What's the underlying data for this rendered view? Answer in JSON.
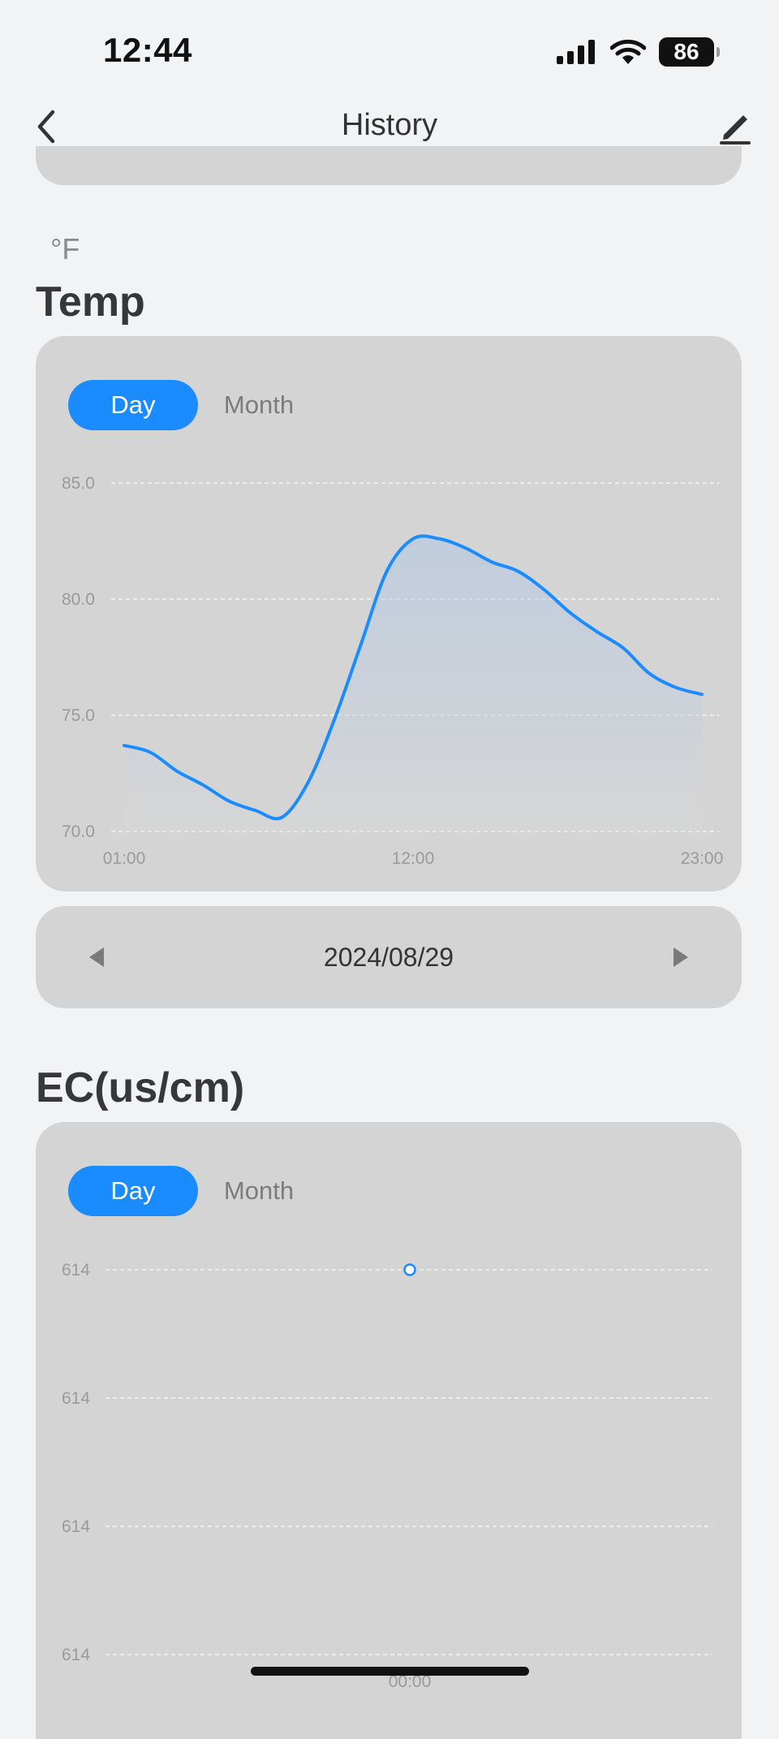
{
  "status_bar": {
    "time": "12:44",
    "battery_level": "86"
  },
  "nav": {
    "title": "History",
    "back_icon": "chevron-left-icon",
    "edit_icon": "pencil-icon"
  },
  "temp_section": {
    "unit": "°F",
    "title": "Temp",
    "tabs": {
      "day": "Day",
      "month": "Month",
      "selected": "Day"
    }
  },
  "date_selector": {
    "date": "2024/08/29",
    "prev_icon": "triangle-left-icon",
    "next_icon": "triangle-right-icon"
  },
  "ec_section": {
    "title": "EC(us/cm)",
    "tabs": {
      "day": "Day",
      "month": "Month",
      "selected": "Day"
    }
  },
  "colors": {
    "accent": "#1a8cff",
    "card": "#d4d4d4",
    "background": "#f2f3f5"
  },
  "chart_data": [
    {
      "type": "area",
      "x_ticks": [
        "01:00",
        "12:00",
        "23:00"
      ],
      "y_ticks": [
        "70.0",
        "75.0",
        "80.0",
        "85.0"
      ],
      "ylim": [
        70,
        85
      ],
      "xlim": [
        1,
        23
      ],
      "grid": true,
      "series": [
        {
          "x": [
            1,
            2,
            3,
            4,
            5,
            6,
            7,
            8,
            9,
            10,
            11,
            12,
            13,
            14,
            15,
            16,
            17,
            18,
            19,
            20,
            21,
            22,
            23
          ],
          "values": [
            73.7,
            73.4,
            72.6,
            72.0,
            71.3,
            70.9,
            70.6,
            72.1,
            74.8,
            78.0,
            81.2,
            82.6,
            82.6,
            82.2,
            81.6,
            81.2,
            80.4,
            79.4,
            78.6,
            77.9,
            76.8,
            76.2,
            75.9
          ]
        }
      ]
    },
    {
      "type": "scatter",
      "x_ticks": [
        "00:00"
      ],
      "y_ticks": [
        "614",
        "614",
        "614",
        "614"
      ],
      "grid": true,
      "series": [
        {
          "x": [
            "00:00"
          ],
          "values": [
            614
          ]
        }
      ]
    }
  ]
}
